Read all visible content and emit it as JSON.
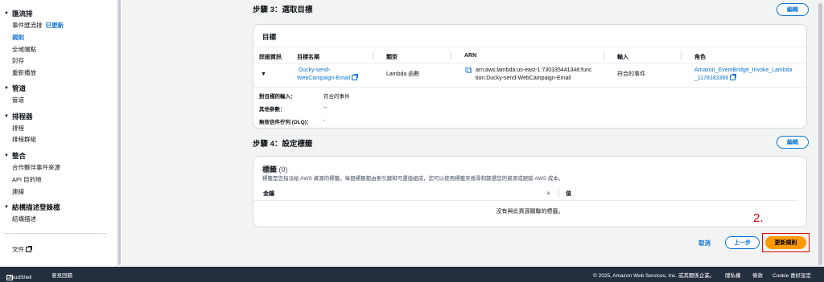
{
  "sidebar": {
    "sections": [
      {
        "title": "匯流排",
        "items": [
          {
            "label": "事件匯流排",
            "badge": "已更新"
          },
          {
            "label": "規則",
            "active": true
          },
          {
            "label": "全域端點"
          },
          {
            "label": "封存"
          },
          {
            "label": "重新播放"
          }
        ]
      },
      {
        "title": "管道",
        "items": [
          {
            "label": "管道"
          }
        ]
      },
      {
        "title": "排程器",
        "items": [
          {
            "label": "排程"
          },
          {
            "label": "排程群組"
          }
        ]
      },
      {
        "title": "整合",
        "items": [
          {
            "label": "合作夥伴事件來源"
          },
          {
            "label": "API 目的地"
          },
          {
            "label": "連線"
          }
        ]
      },
      {
        "title": "結構描述登錄檔",
        "items": [
          {
            "label": "結構描述"
          }
        ]
      }
    ],
    "docs_label": "文件"
  },
  "step3": {
    "title": "步驟 3：選取目標",
    "edit_label": "編輯",
    "panel_title": "目標",
    "columns": [
      "詳細資訊",
      "目標名稱",
      "類型",
      "ARN",
      "輸入",
      "角色"
    ],
    "row": {
      "name_line1": "Ducky-send-",
      "name_line2": "WebCampaign-Email",
      "type": "Lambda 函數",
      "arn_line1": "arn:aws:lambda:us-east-1:730335441348:func",
      "arn_line2": "tion:Ducky-send-WebCampaign-Email",
      "input": "符合的事件",
      "role_line1": "Amazon_EventBridge_Invoke_Lambda",
      "role_line2": "_1178183366"
    },
    "details": [
      {
        "label": "對目標的輸入：",
        "value": "符合的事件"
      },
      {
        "label": "其他參數：",
        "value": "--"
      },
      {
        "label": "無效信件佇列 (DLQ)：",
        "value": "-"
      }
    ]
  },
  "step4": {
    "title": "步驟 4：設定標籤",
    "edit_label": "編輯",
    "tags_title": "標籤",
    "tags_count": "(0)",
    "tags_desc": "標籤是您指派給 AWS 資源的標籤。每個標籤都由索引鍵和可選值組成，您可以使用標籤來搜尋和篩選您的資源或跟蹤 AWS 成本。",
    "col_key": "金鑰",
    "col_value": "值",
    "empty": "沒有與此資源關聯的標籤。"
  },
  "actions": {
    "cancel": "取消",
    "previous": "上一步",
    "update": "更新規則",
    "annotation": "2."
  },
  "footer": {
    "cloudshell": "CloudShell",
    "feedback": "意見回饋",
    "copyright": "© 2025, Amazon Web Services, Inc. 或其關係企業。",
    "privacy": "隱私權",
    "terms": "條款",
    "cookies": "Cookie 喜好設定"
  },
  "colors": {
    "accent": "#0972d3",
    "primary_button": "#ff9900",
    "annotation": "#d40000",
    "footer_bg": "#232f3e"
  }
}
